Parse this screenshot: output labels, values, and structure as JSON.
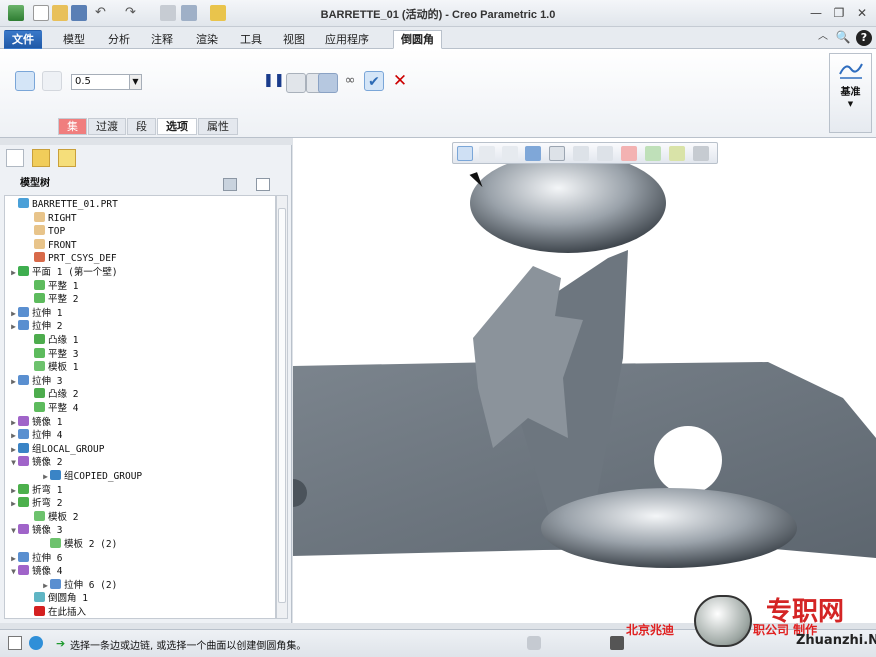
{
  "window": {
    "title": "BARRETTE_01 (活动的) - Creo Parametric 1.0"
  },
  "tabs": [
    "文件",
    "模型",
    "分析",
    "注释",
    "渲染",
    "工具",
    "视图",
    "应用程序",
    "倒圆角"
  ],
  "ribbon": {
    "radius_value": "0.5",
    "sub_tabs": [
      "集",
      "过渡",
      "段",
      "选项",
      "属性"
    ],
    "datum_label": "基准"
  },
  "model_tree": {
    "header": "模型树",
    "nodes": [
      {
        "label": "BARRETTE_01.PRT",
        "icon": "part-icon"
      },
      {
        "label": "RIGHT",
        "icon": "datum-plane-icon"
      },
      {
        "label": "TOP",
        "icon": "datum-plane-icon"
      },
      {
        "label": "FRONT",
        "icon": "datum-plane-icon"
      },
      {
        "label": "PRT_CSYS_DEF",
        "icon": "csys-icon"
      },
      {
        "label": "平面 1 (第一个壁)",
        "icon": "wall-icon"
      },
      {
        "label": "平整 1",
        "icon": "flat-icon"
      },
      {
        "label": "平整 2",
        "icon": "flat-icon"
      },
      {
        "label": "拉伸 1",
        "icon": "extrude-icon"
      },
      {
        "label": "拉伸 2",
        "icon": "extrude-icon"
      },
      {
        "label": "凸缘 1",
        "icon": "flange-icon"
      },
      {
        "label": "平整 3",
        "icon": "flat-icon"
      },
      {
        "label": "模板 1",
        "icon": "form-icon"
      },
      {
        "label": "拉伸 3",
        "icon": "extrude-icon"
      },
      {
        "label": "凸缘 2",
        "icon": "flange-icon"
      },
      {
        "label": "平整 4",
        "icon": "flat-icon"
      },
      {
        "label": "镜像 1",
        "icon": "mirror-icon"
      },
      {
        "label": "拉伸 4",
        "icon": "extrude-icon"
      },
      {
        "label": "组LOCAL_GROUP",
        "icon": "group-icon"
      },
      {
        "label": "镜像 2",
        "icon": "mirror-icon"
      },
      {
        "label": "组COPIED_GROUP",
        "icon": "group-icon"
      },
      {
        "label": "折弯 1",
        "icon": "bend-icon"
      },
      {
        "label": "折弯 2",
        "icon": "bend-icon"
      },
      {
        "label": "模板 2",
        "icon": "form-icon"
      },
      {
        "label": "镜像 3",
        "icon": "mirror-icon"
      },
      {
        "label": "模板 2 (2)",
        "icon": "form-icon"
      },
      {
        "label": "拉伸 6",
        "icon": "extrude-icon"
      },
      {
        "label": "镜像 4",
        "icon": "mirror-icon"
      },
      {
        "label": "拉伸 6 (2)",
        "icon": "extrude-icon"
      },
      {
        "label": "倒圆角 1",
        "icon": "round-icon"
      },
      {
        "label": "在此插入",
        "icon": "insert-here-icon"
      }
    ]
  },
  "status": {
    "message": "选择一条边或边链, 或选择一个曲面以创建倒圆角集。"
  },
  "watermark": {
    "left_text": "北京兆迪",
    "mid_text": "职公司 制作",
    "brand": "专职网",
    "url": "Zhuanzhi.Net"
  },
  "colors": {
    "accent": "#2f6dbf",
    "model": "#5d666f"
  }
}
